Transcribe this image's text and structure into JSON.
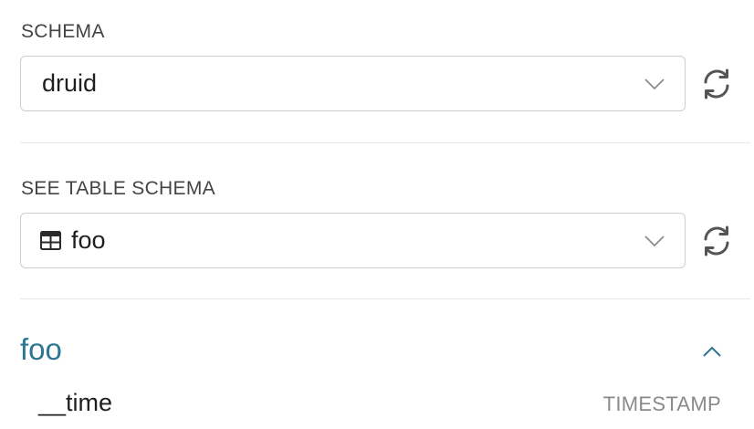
{
  "schema_section": {
    "label": "SCHEMA",
    "selected_value": "druid"
  },
  "table_section": {
    "label": "SEE TABLE SCHEMA",
    "selected_value": "foo"
  },
  "table_detail": {
    "title": "foo",
    "columns": [
      {
        "name": "__time",
        "type": "TIMESTAMP"
      }
    ]
  },
  "colors": {
    "accent": "#2d7693",
    "icon": "#555555",
    "border": "#cfcfcf"
  }
}
